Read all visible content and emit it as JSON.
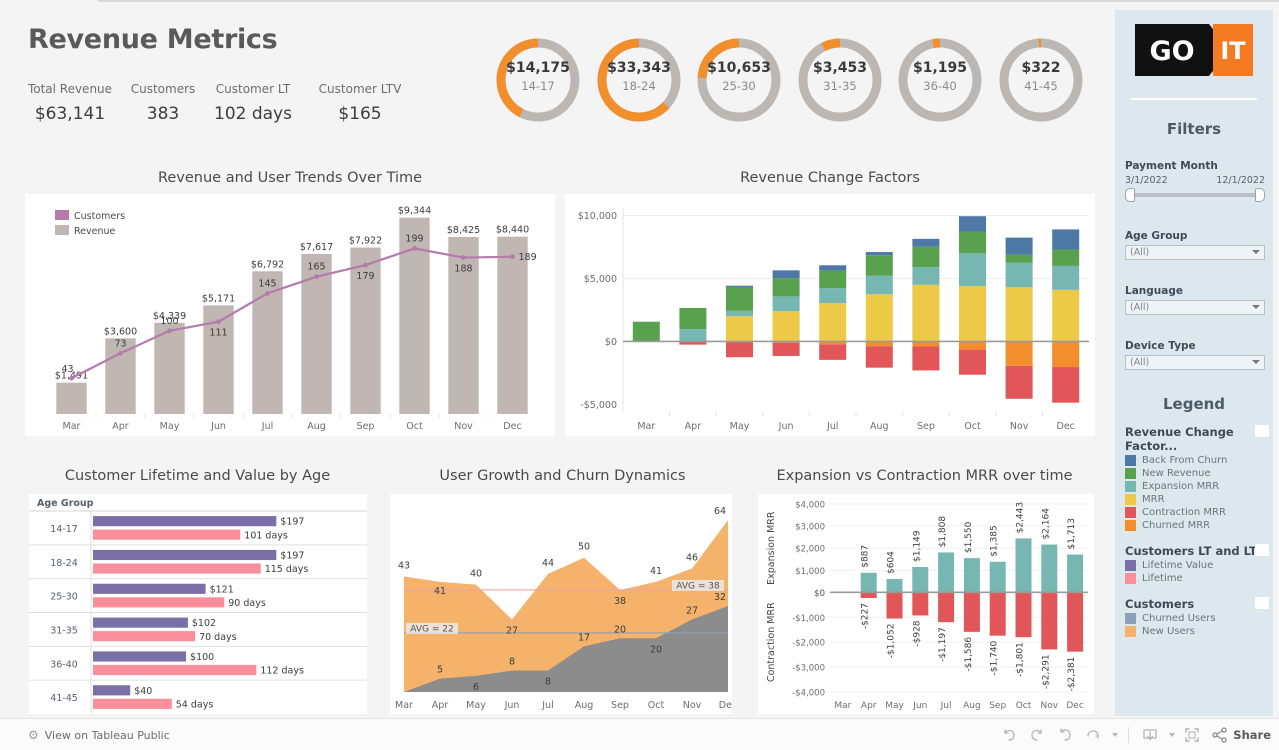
{
  "header": {
    "title": "Revenue Metrics",
    "kpis": [
      {
        "label": "Total Revenue",
        "value": "$63,141"
      },
      {
        "label": "Customers",
        "value": "383"
      },
      {
        "label": "Customer LT",
        "value": "102 days"
      },
      {
        "label": "Customer LTV",
        "value": "$165"
      }
    ]
  },
  "donuts": [
    {
      "value": "$14,175",
      "group": "14-17",
      "pct": 42.5
    },
    {
      "value": "$33,343",
      "group": "18-24",
      "pct": 63.0
    },
    {
      "value": "$10,653",
      "group": "25-30",
      "pct": 24.0
    },
    {
      "value": "$3,453",
      "group": "31-35",
      "pct": 7.5
    },
    {
      "value": "$1,195",
      "group": "36-40",
      "pct": 3.0
    },
    {
      "value": "$322",
      "group": "41-45",
      "pct": 1.0
    }
  ],
  "sidebar": {
    "logo": {
      "left_text": "GO",
      "right_text": "IT"
    },
    "filters_heading": "Filters",
    "legend_heading": "Legend",
    "filters": [
      {
        "label": "Payment Month",
        "type": "range",
        "min": "3/1/2022",
        "max": "12/1/2022"
      },
      {
        "label": "Age Group",
        "type": "select",
        "value": "(All)"
      },
      {
        "label": "Language",
        "type": "select",
        "value": "(All)"
      },
      {
        "label": "Device Type",
        "type": "select",
        "value": "(All)"
      }
    ],
    "legend_groups": [
      {
        "title": "Revenue Change Factor...",
        "items": [
          {
            "label": "Back From Churn",
            "color": "#4e79a7"
          },
          {
            "label": "New Revenue",
            "color": "#59a14f"
          },
          {
            "label": "Expansion MRR",
            "color": "#76b7b2"
          },
          {
            "label": "MRR",
            "color": "#edc948"
          },
          {
            "label": "Contraction MRR",
            "color": "#e15759"
          },
          {
            "label": "Churned MRR",
            "color": "#f28e2b"
          }
        ]
      },
      {
        "title": "Customers LT and LTV",
        "items": [
          {
            "label": "Lifetime Value",
            "color": "#7b6fa8"
          },
          {
            "label": "Lifetime",
            "color": "#fa8e9b"
          }
        ]
      },
      {
        "title": "Customers",
        "items": [
          {
            "label": "Churned Users",
            "color": "#8da0b9"
          },
          {
            "label": "New Users",
            "color": "#f4b26a"
          }
        ]
      }
    ]
  },
  "panels": {
    "revenue_trends_title": "Revenue and User Trends Over Time",
    "change_factors_title": "Revenue Change Factors",
    "lifetime_title": "Customer Lifetime and Value by Age",
    "growth_title": "User Growth and Churn Dynamics",
    "mrr_title": "Expansion vs Contraction MRR over time"
  },
  "footer": {
    "view_on": "View on Tableau Public",
    "share": "Share",
    "buttons": [
      "undo",
      "redo",
      "revert",
      "refresh",
      "refresh-menu",
      "download",
      "fullscreen"
    ]
  },
  "chart_data": [
    {
      "type": "bar",
      "name": "revenue_trends",
      "title": "Revenue and User Trends Over Time",
      "categories": [
        "Mar",
        "Apr",
        "May",
        "Jun",
        "Jul",
        "Aug",
        "Sep",
        "Oct",
        "Nov",
        "Dec"
      ],
      "xlabel": "",
      "ylabel": "",
      "grid": false,
      "legend_position": "top-left",
      "series": [
        {
          "name": "Revenue",
          "type": "bar",
          "color": "#c0b6b2",
          "values": [
            1491,
            3600,
            4339,
            5171,
            6792,
            7617,
            7922,
            9344,
            8425,
            8440
          ],
          "labels": [
            "$1,491",
            "$3,600",
            "$4,339",
            "$5,171",
            "$6,792",
            "$7,617",
            "$7,922",
            "$9,344",
            "$8,425",
            "$8,440"
          ],
          "ylim": [
            0,
            9344
          ]
        },
        {
          "name": "Customers",
          "type": "line",
          "color": "#b57bab",
          "values": [
            43,
            73,
            100,
            111,
            145,
            165,
            179,
            199,
            188,
            189
          ],
          "labels": [
            "43",
            "73",
            "100",
            "111",
            "145",
            "165",
            "179",
            "199",
            "188",
            "189"
          ],
          "ylim": [
            0,
            199
          ]
        }
      ]
    },
    {
      "type": "bar",
      "name": "revenue_change_factors",
      "title": "Revenue Change Factors",
      "categories": [
        "Mar",
        "Apr",
        "May",
        "Jun",
        "Jul",
        "Aug",
        "Sep",
        "Oct",
        "Nov",
        "Dec"
      ],
      "stacked": true,
      "ylim": [
        -5000,
        10000
      ],
      "yticks": [
        "$10,000",
        "$5,000",
        "$0",
        "-$5,000"
      ],
      "grid": true,
      "series": [
        {
          "name": "MRR",
          "color": "#edc948",
          "values": [
            0,
            0,
            2000,
            2400,
            3050,
            3750,
            4500,
            4400,
            4300,
            4100
          ]
        },
        {
          "name": "Expansion MRR",
          "color": "#76b7b2",
          "values": [
            0,
            980,
            430,
            1180,
            1180,
            1470,
            1400,
            2600,
            1950,
            1900
          ]
        },
        {
          "name": "New Revenue",
          "color": "#59a14f",
          "values": [
            1570,
            1680,
            1900,
            1450,
            1400,
            1630,
            1630,
            1730,
            650,
            1300
          ]
        },
        {
          "name": "Back From Churn",
          "color": "#4e79a7",
          "values": [
            0,
            0,
            100,
            620,
            420,
            250,
            620,
            1220,
            1350,
            1600
          ]
        },
        {
          "name": "Churned MRR",
          "color": "#f28e2b",
          "values": [
            0,
            0,
            -80,
            -90,
            -230,
            -380,
            -400,
            -650,
            -1930,
            -2030
          ]
        },
        {
          "name": "Contraction MRR",
          "color": "#e15759",
          "values": [
            0,
            -250,
            -1170,
            -1060,
            -1230,
            -1700,
            -1900,
            -1990,
            -2620,
            -2830
          ]
        }
      ]
    },
    {
      "type": "bar",
      "name": "customer_lifetime_value_by_age",
      "title": "Customer Lifetime and Value by Age",
      "orientation": "horizontal",
      "group_header": "Age Group",
      "categories": [
        "14-17",
        "18-24",
        "25-30",
        "31-35",
        "36-40",
        "41-45"
      ],
      "series": [
        {
          "name": "Lifetime Value",
          "color": "#7b6fa8",
          "values": [
            197,
            197,
            121,
            102,
            100,
            40
          ],
          "labels": [
            "$197",
            "$197",
            "$121",
            "$102",
            "$100",
            "$40"
          ]
        },
        {
          "name": "Lifetime",
          "color": "#fa8e9b",
          "values": [
            101,
            115,
            90,
            70,
            112,
            54
          ],
          "labels": [
            "101 days",
            "115 days",
            "90 days",
            "70 days",
            "112 days",
            "54 days"
          ]
        }
      ]
    },
    {
      "type": "area",
      "name": "user_growth_churn",
      "title": "User Growth and Churn Dynamics",
      "categories": [
        "Mar",
        "Apr",
        "May",
        "Jun",
        "Jul",
        "Aug",
        "Sep",
        "Oct",
        "Nov",
        "Dec"
      ],
      "ylim": [
        0,
        64
      ],
      "reference_lines": [
        {
          "label": "AVG = 38",
          "value": 38,
          "color": "#f0a3a3"
        },
        {
          "label": "AVG = 22",
          "value": 22,
          "color": "#8da0b9"
        }
      ],
      "series": [
        {
          "name": "New Users",
          "color": "#f4b26a",
          "values": [
            43,
            41,
            40,
            27,
            44,
            50,
            38,
            41,
            46,
            64
          ],
          "labels": [
            "43",
            "41",
            "40",
            "27",
            "44",
            "50",
            "38",
            "41",
            "46",
            "64"
          ]
        },
        {
          "name": "Churned Users",
          "color": "#8c8c8c",
          "values": [
            0,
            5,
            6,
            8,
            8,
            17,
            20,
            20,
            27,
            32
          ],
          "labels": [
            "",
            "5",
            "6",
            "8",
            "8",
            "17",
            "20",
            "20",
            "27",
            "32"
          ]
        }
      ]
    },
    {
      "type": "bar",
      "name": "expansion_vs_contraction_mrr",
      "title": "Expansion vs Contraction MRR over time",
      "categories": [
        "Mar",
        "Apr",
        "May",
        "Jun",
        "Jul",
        "Aug",
        "Sep",
        "Oct",
        "Nov",
        "Dec"
      ],
      "axis_labels": {
        "top": "Expansion MRR",
        "bottom": "Contraction MRR"
      },
      "yticks_top": [
        "$4,000",
        "$3,000",
        "$2,000",
        "$1,000",
        "$0"
      ],
      "yticks_bottom": [
        "$0",
        "-$1,000",
        "-$2,000",
        "-$3,000",
        "-$4,000"
      ],
      "ylim_top": [
        0,
        4000
      ],
      "ylim_bottom": [
        -4000,
        0
      ],
      "grid": true,
      "series": [
        {
          "name": "Expansion MRR",
          "color": "#76b7b2",
          "values": [
            null,
            887,
            604,
            1149,
            1808,
            1550,
            1385,
            2443,
            2164,
            1713
          ],
          "labels": [
            "",
            "$887",
            "$604",
            "$1,149",
            "$1,808",
            "$1,550",
            "$1,385",
            "$2,443",
            "$2,164",
            "$1,713"
          ]
        },
        {
          "name": "Contraction MRR",
          "color": "#e15759",
          "values": [
            null,
            -227,
            -1052,
            -928,
            -1197,
            -1586,
            -1740,
            -1801,
            -2291,
            -2381
          ],
          "labels": [
            "",
            "-$227",
            "-$1,052",
            "-$928",
            "-$1,197",
            "-$1,586",
            "-$1,740",
            "-$1,801",
            "-$2,291",
            "-$2,381"
          ]
        }
      ]
    }
  ]
}
